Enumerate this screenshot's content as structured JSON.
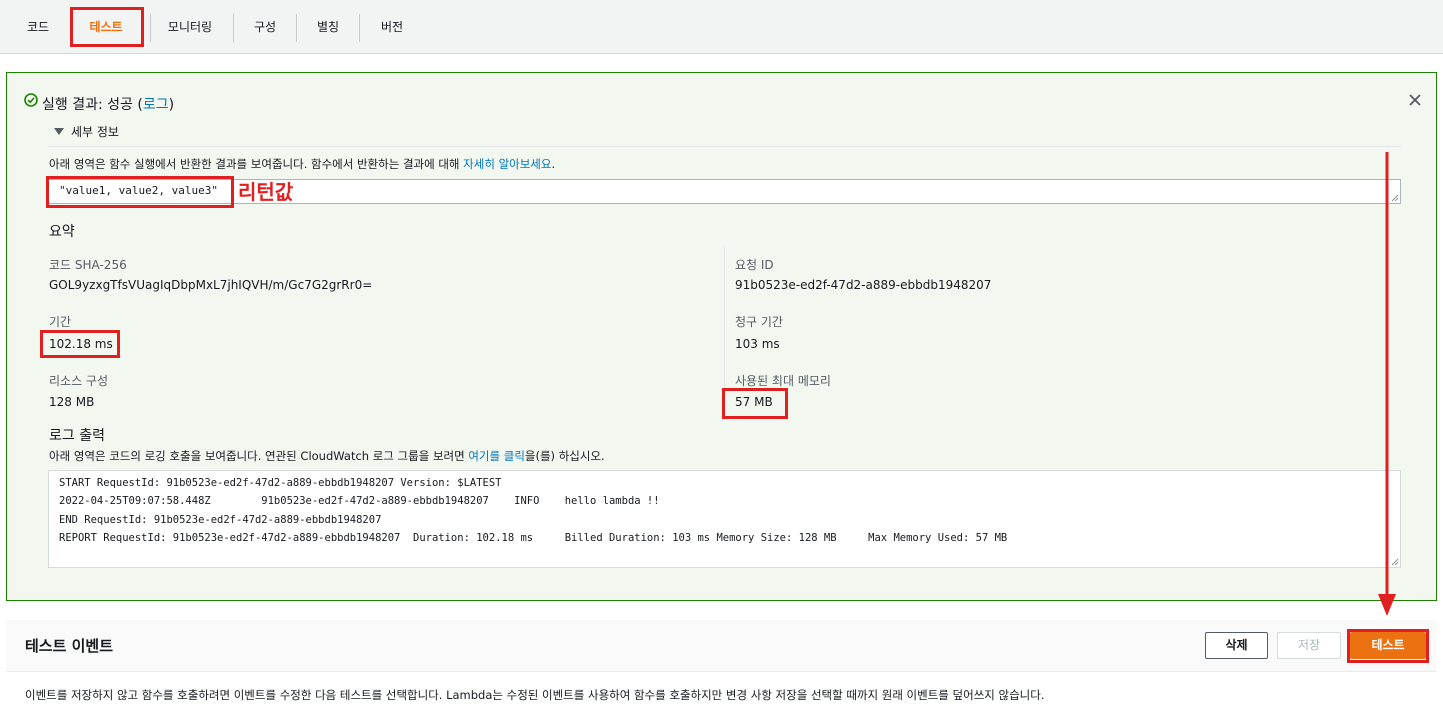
{
  "tabs": [
    {
      "label": "코드"
    },
    {
      "label": "테스트"
    },
    {
      "label": "모니터링"
    },
    {
      "label": "구성"
    },
    {
      "label": "별칭"
    },
    {
      "label": "버전"
    }
  ],
  "result": {
    "title_prefix": "실행 결과: 성공 (",
    "title_link": "로그",
    "title_suffix": ")",
    "details_label": "세부 정보",
    "desc_prefix": "아래 영역은 함수 실행에서 반환한 결과를 보여줍니다. 함수에서 반환하는 결과에 대해 ",
    "desc_link": "자세히 알아보세요",
    "desc_suffix": ".",
    "return_value": "\"value1, value2, value3\"",
    "summary_title": "요약",
    "code_sha_label": "코드 SHA-256",
    "code_sha_value": "GOL9yzxgTfsVUagIqDbpMxL7jhIQVH/m/Gc7G2grRr0=",
    "request_id_label": "요청 ID",
    "request_id_value": "91b0523e-ed2f-47d2-a889-ebbdb1948207",
    "duration_label": "기간",
    "duration_value": "102.18 ms",
    "billed_duration_label": "청구 기간",
    "billed_duration_value": "103 ms",
    "resources_label": "리소스 구성",
    "resources_value": "128 MB",
    "max_memory_label": "사용된 최대 메모리",
    "max_memory_value": "57 MB",
    "log_title": "로그 출력",
    "log_desc_prefix": "아래 영역은 코드의 로깅 호출을 보여줍니다. 연관된 CloudWatch 로그 그룹을 보려면 ",
    "log_desc_link": "여기를 클릭",
    "log_desc_suffix": "을(를) 하십시오.",
    "log_lines": [
      "START RequestId: 91b0523e-ed2f-47d2-a889-ebbdb1948207 Version: $LATEST",
      "2022-04-25T09:07:58.448Z        91b0523e-ed2f-47d2-a889-ebbdb1948207    INFO    hello lambda !!",
      "END RequestId: 91b0523e-ed2f-47d2-a889-ebbdb1948207",
      "REPORT RequestId: 91b0523e-ed2f-47d2-a889-ebbdb1948207  Duration: 102.18 ms     Billed Duration: 103 ms Memory Size: 128 MB     Max Memory Used: 57 MB"
    ]
  },
  "annotation": {
    "return_label": "리턴값"
  },
  "test_event": {
    "title": "테스트 이벤트",
    "delete_label": "삭제",
    "save_label": "저장",
    "test_label": "테스트",
    "description": "이벤트를 저장하지 않고 함수를 호출하려면 이벤트를 수정한 다음 테스트를 선택합니다. Lambda는 수정된 이벤트를 사용하여 함수를 호출하지만 변경 사항 저장을 선택할 때까지 원래 이벤트를 덮어쓰지 않습니다."
  },
  "colors": {
    "accent": "#ec7211",
    "success": "#1d8102",
    "link": "#0073bb",
    "annotation": "#e02020"
  },
  "icons": [
    "check-circle-icon",
    "close-icon",
    "caret-down-icon",
    "resize-grip-icon",
    "arrow-down-icon"
  ]
}
